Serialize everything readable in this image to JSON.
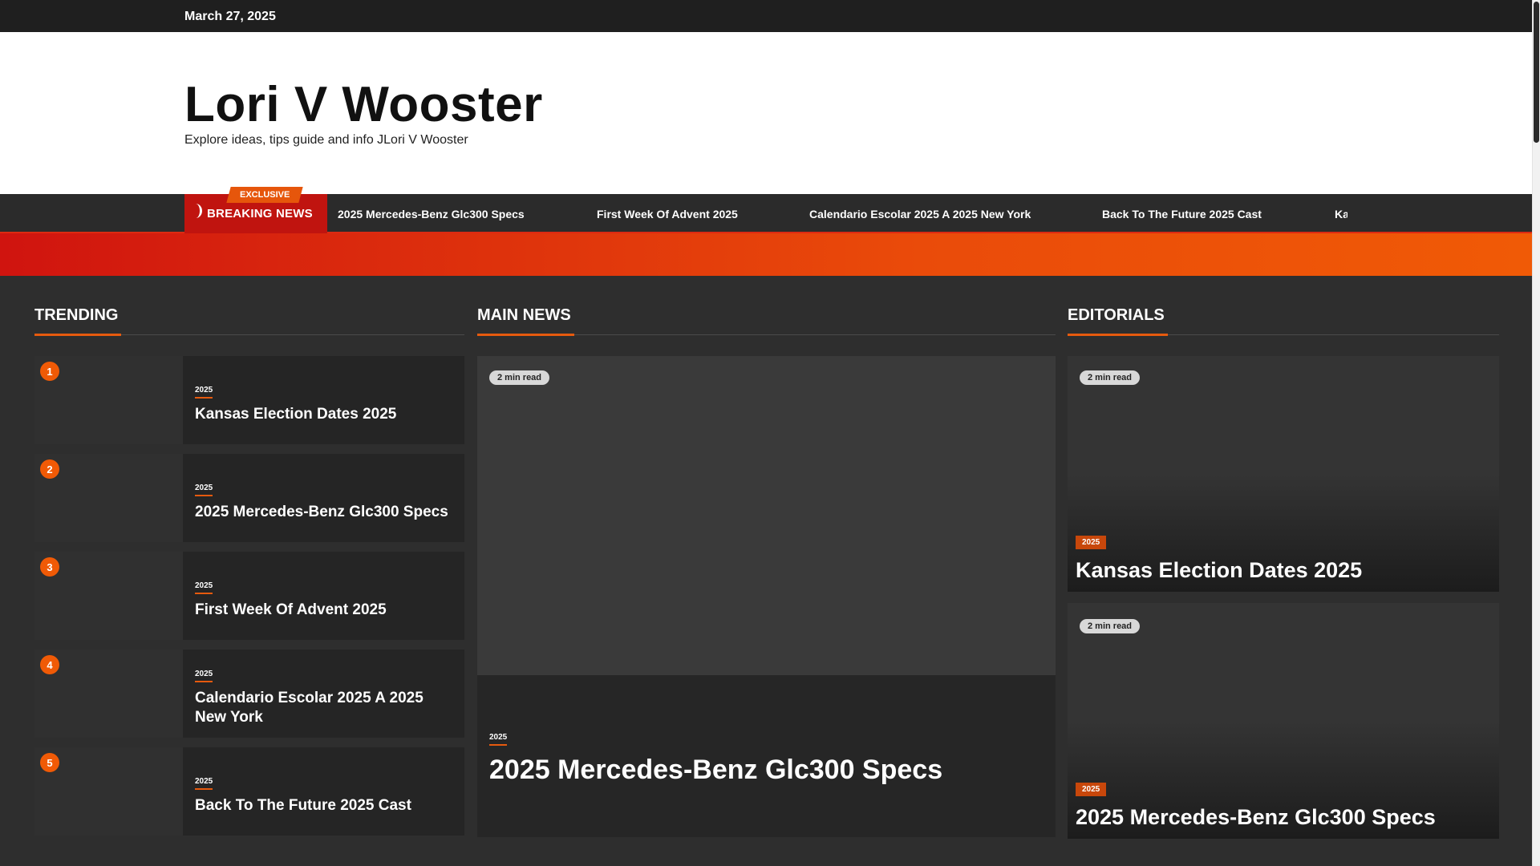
{
  "topbar": {
    "date": "March 27, 2025"
  },
  "site": {
    "title": "Lori V Wooster",
    "description": "Explore ideas, tips guide and info JLori V Wooster"
  },
  "ticker": {
    "exclusive": "EXCLUSIVE",
    "breaking_label": "BREAKING NEWS",
    "items": [
      "2025 Mercedes-Benz Glc300 Specs",
      "First Week Of Advent 2025",
      "Calendario Escolar 2025 A 2025 New York",
      "Back To The Future 2025 Cast",
      "Ka"
    ]
  },
  "sections": {
    "trending": "TRENDING",
    "main": "MAIN NEWS",
    "editorials": "EDITORIALS"
  },
  "trending": [
    {
      "num": "1",
      "cat": "2025",
      "title": "Kansas Election Dates 2025"
    },
    {
      "num": "2",
      "cat": "2025",
      "title": "2025 Mercedes-Benz Glc300 Specs"
    },
    {
      "num": "3",
      "cat": "2025",
      "title": "First Week Of Advent 2025"
    },
    {
      "num": "4",
      "cat": "2025",
      "title": "Calendario Escolar 2025 A 2025 New York"
    },
    {
      "num": "5",
      "cat": "2025",
      "title": "Back To The Future 2025 Cast"
    }
  ],
  "main_news": {
    "read_time": "2 min read",
    "cat": "2025",
    "title": "2025 Mercedes-Benz Glc300 Specs"
  },
  "editorials": [
    {
      "read_time": "2 min read",
      "cat": "2025",
      "title": "Kansas Election Dates 2025"
    },
    {
      "read_time": "2 min read",
      "cat": "2025",
      "title": "2025 Mercedes-Benz Glc300 Specs"
    }
  ],
  "colors": {
    "accent": "#e65a0e",
    "breaking": "#c0140f",
    "dark_bg": "#2e2e2e"
  }
}
